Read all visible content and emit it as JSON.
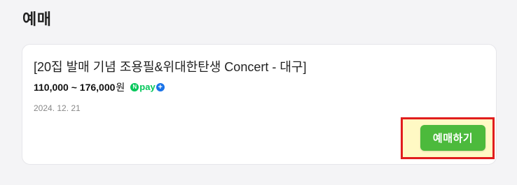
{
  "section": {
    "title": "예매"
  },
  "event": {
    "title": "[20집 발매 기념 조용필&위대한탄생 Concert - 대구]",
    "price_range": "110,000 ~ 176,000",
    "price_unit": "원",
    "date": "2024. 12. 21"
  },
  "npay": {
    "icon": "naver-pay-plus-icon",
    "n_letter": "N",
    "word": "pay",
    "plus": "+"
  },
  "actions": {
    "reserve_label": "예매하기"
  },
  "colors": {
    "button_green": "#4cba3c",
    "highlight_fill": "#fff9c4",
    "highlight_border": "#e11d1d",
    "npay_green": "#03c75a",
    "npay_blue": "#1a73e8"
  }
}
